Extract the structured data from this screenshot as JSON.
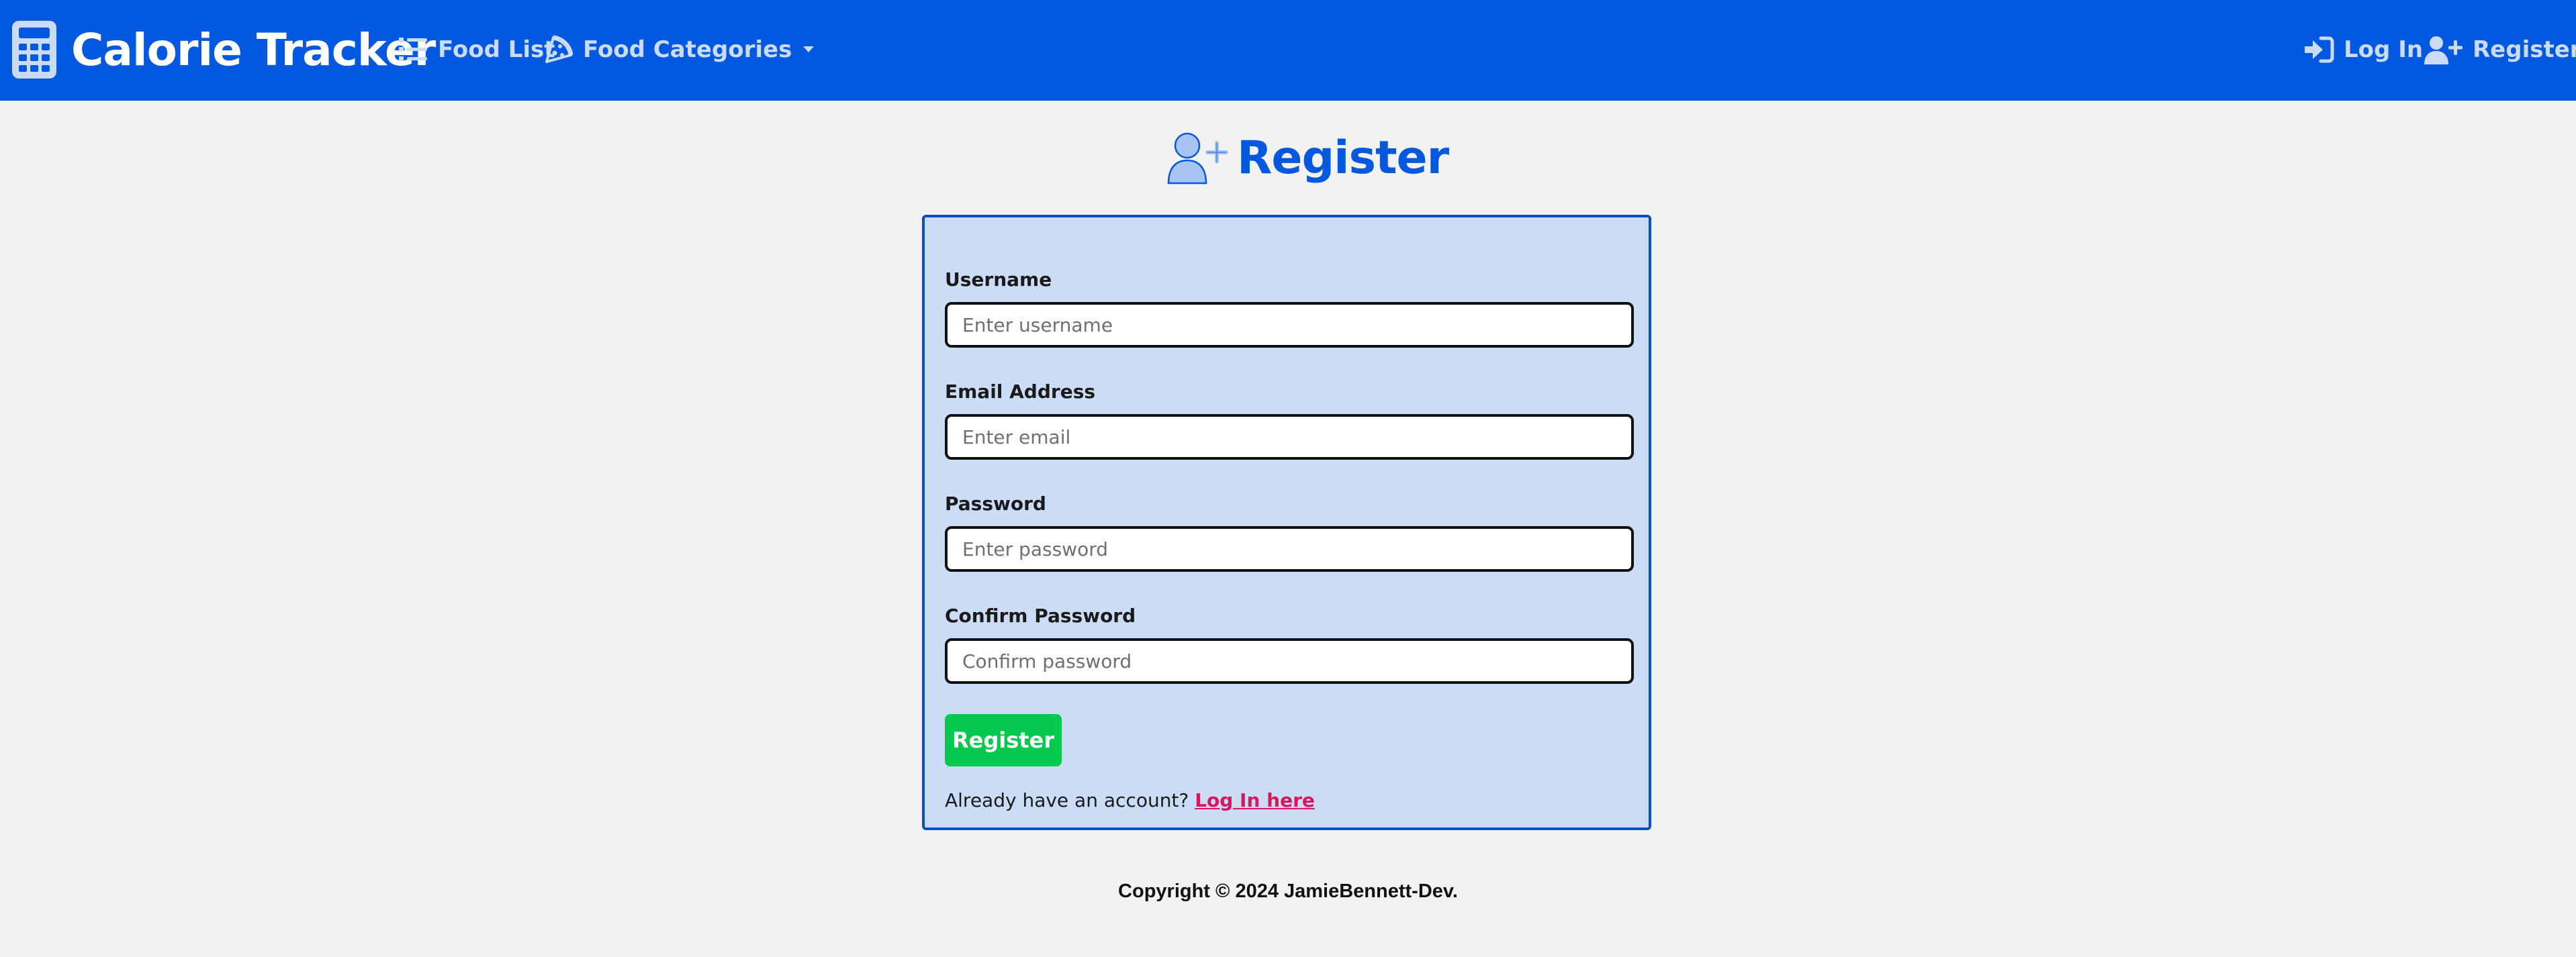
{
  "app": {
    "brand": "Calorie Tracker"
  },
  "nav": {
    "food_list": "Food List",
    "food_categories": "Food Categories",
    "log_in": "Log In",
    "register": "Register"
  },
  "page": {
    "title": "Register"
  },
  "form": {
    "fields": [
      {
        "label": "Username",
        "placeholder": "Enter username",
        "value": ""
      },
      {
        "label": "Email Address",
        "placeholder": "Enter email",
        "value": ""
      },
      {
        "label": "Password",
        "placeholder": "Enter password",
        "value": ""
      },
      {
        "label": "Confirm Password",
        "placeholder": "Confirm password",
        "value": ""
      }
    ],
    "submit_label": "Register",
    "login_prompt": "Already have an account?",
    "login_link": "Log In here"
  },
  "footer": {
    "copyright": "Copyright © 2024 JamieBennett-Dev."
  },
  "colors": {
    "navbar": "#0258df",
    "nav_link": "#c9dbf7",
    "card_bg": "#cbdcf7",
    "card_border": "#0a4fbd",
    "submit": "#05c84f",
    "link": "#d6195c",
    "page_bg": "#f2f2f2"
  },
  "icons": {
    "brand": "calculator-icon",
    "food_list": "list-icon",
    "food_categories": "pizza-icon",
    "log_in": "sign-in-icon",
    "register": "user-plus-icon"
  }
}
